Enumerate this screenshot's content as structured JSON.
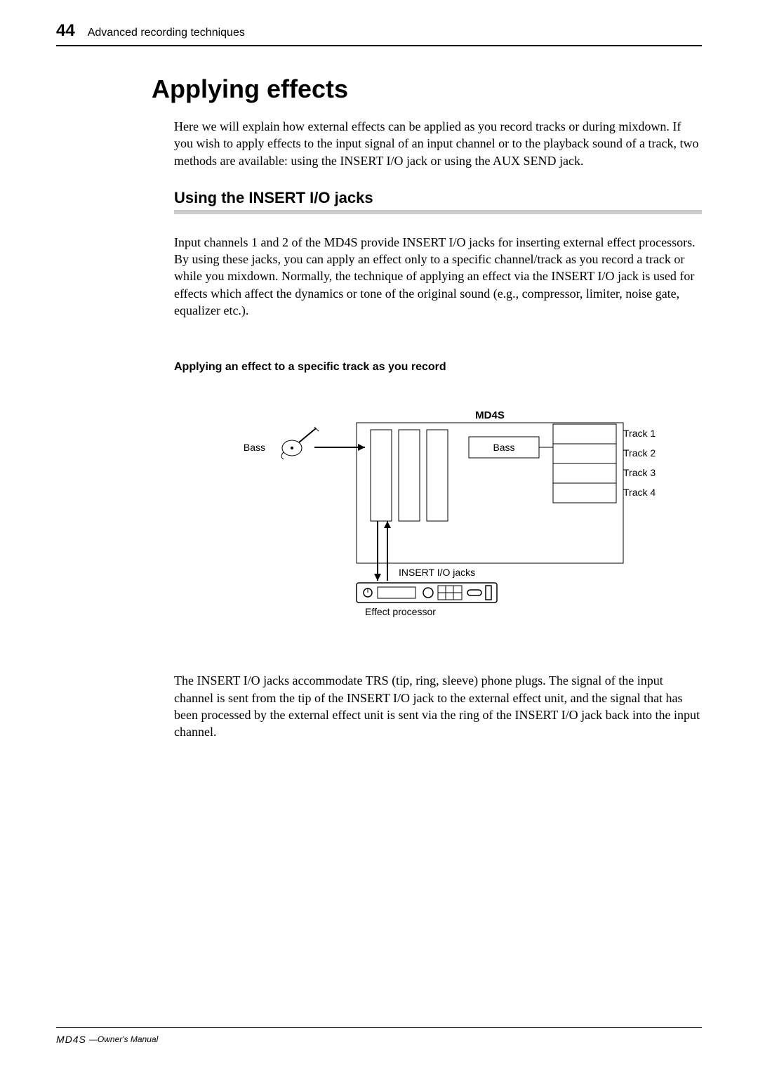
{
  "page_number": "44",
  "header_text": "Advanced recording techniques",
  "section_title": "Applying effects",
  "intro_paragraph": "Here we will explain how external effects can be applied as you record tracks or during mixdown. If you wish to apply effects to the input signal of an input channel or to the playback sound of a track, two methods are available: using the INSERT I/O jack or using the AUX SEND jack.",
  "subsection_title": "Using the INSERT I/O jacks",
  "subsection_paragraph": "Input channels 1 and 2 of the MD4S provide INSERT I/O jacks for inserting external effect processors. By using these jacks, you can apply an effect only to a specific channel/track as you record a track or while you mixdown. Normally, the technique of applying an effect via the INSERT I/O jack is used for effects which affect the dynamics or tone of the original sound (e.g., compressor, limiter, noise gate, equalizer etc.).",
  "sub_sub_title": "Applying an effect to a specific track as you record",
  "diagram": {
    "device_label": "MD4S",
    "input_label": "Bass",
    "channel_box_label": "Bass",
    "tracks": [
      "Track 1",
      "Track 2",
      "Track 3",
      "Track 4"
    ],
    "insert_label": "INSERT I/O jacks",
    "processor_label": "Effect processor"
  },
  "post_diagram_paragraph": "The INSERT I/O jacks accommodate TRS (tip, ring, sleeve) phone plugs. The signal of the input channel is sent from the tip of the INSERT I/O jack to the external effect unit, and the signal that has been processed by the external effect unit is sent via the ring of the INSERT I/O jack back into the input channel.",
  "footer_brand": "MD4S",
  "footer_text": "—Owner's Manual"
}
